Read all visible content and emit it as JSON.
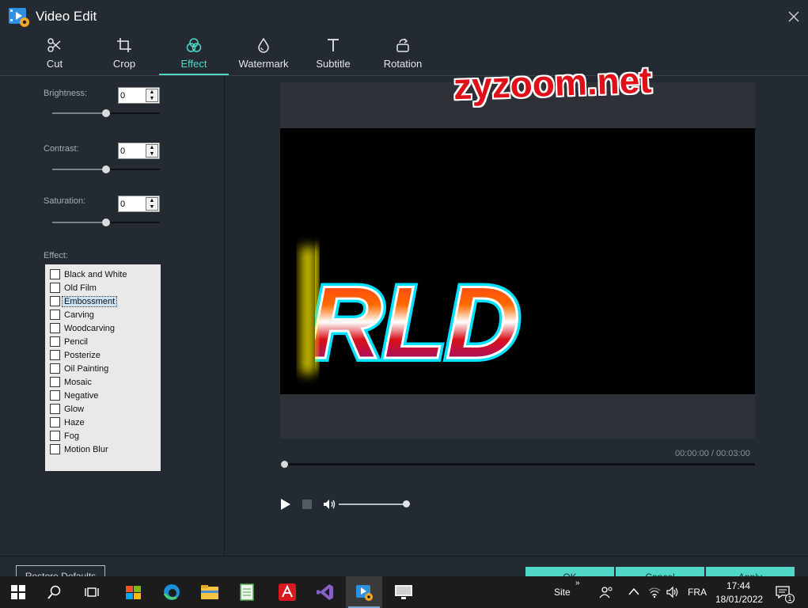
{
  "window": {
    "title": "Video Edit"
  },
  "tabs": [
    {
      "label": "Cut",
      "icon": "scissors-icon"
    },
    {
      "label": "Crop",
      "icon": "crop-icon"
    },
    {
      "label": "Effect",
      "icon": "effect-icon",
      "active": true
    },
    {
      "label": "Watermark",
      "icon": "drop-icon"
    },
    {
      "label": "Subtitle",
      "icon": "text-icon"
    },
    {
      "label": "Rotation",
      "icon": "rotate-icon"
    }
  ],
  "controls": {
    "brightness": {
      "label": "Brightness:",
      "value": "0"
    },
    "contrast": {
      "label": "Contrast:",
      "value": "0"
    },
    "saturation": {
      "label": "Saturation:",
      "value": "0"
    }
  },
  "effects": {
    "label": "Effect:",
    "items": [
      "Black and White",
      "Old Film",
      "Embossment",
      "Carving",
      "Woodcarving",
      "Pencil",
      "Posterize",
      "Oil Painting",
      "Mosaic",
      "Negative",
      "Glow",
      "Haze",
      "Fog",
      "Motion Blur"
    ],
    "selected": "Embossment"
  },
  "preview": {
    "video_text": "RLD",
    "watermark_overlay": "zyzoom.net",
    "time": "00:00:00 / 00:03:00",
    "volume_fraction": 0.95
  },
  "buttons": {
    "restore": "Restore Defaults",
    "ok": "OK",
    "cancel": "Cancel",
    "apply": "Apply"
  },
  "taskbar": {
    "site_label": "Site",
    "language": "FRA",
    "time": "17:44",
    "date": "18/01/2022",
    "notification_count": "1"
  },
  "colors": {
    "accent": "#4fd8c8",
    "background": "#242a31",
    "watermark": "#e0101a"
  }
}
